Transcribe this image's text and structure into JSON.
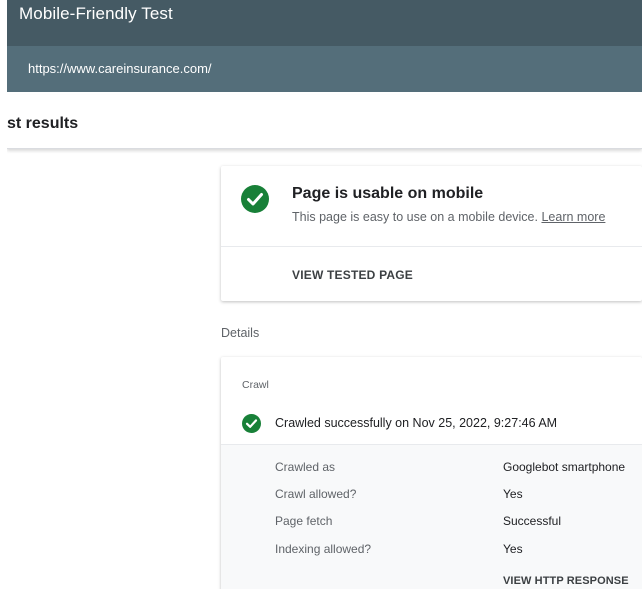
{
  "header": {
    "title": "Mobile-Friendly Test",
    "url": "https://www.careinsurance.com/"
  },
  "results": {
    "title": "st results"
  },
  "usable_card": {
    "title": "Page is usable on mobile",
    "subtitle": "This page is easy to use on a mobile device.",
    "learn_more": "Learn more",
    "view_tested_page": "VIEW TESTED PAGE"
  },
  "details": {
    "label": "Details",
    "crawl_label": "Crawl",
    "crawl_status": "Crawled successfully on Nov 25, 2022, 9:27:46 AM",
    "rows": [
      {
        "key": "Crawled as",
        "value": "Googlebot smartphone"
      },
      {
        "key": "Crawl allowed?",
        "value": "Yes"
      },
      {
        "key": "Page fetch",
        "value": "Successful"
      },
      {
        "key": "Indexing allowed?",
        "value": "Yes"
      }
    ],
    "view_http_response": "VIEW HTTP RESPONSE"
  },
  "colors": {
    "app_bar": "#455a64",
    "url_bar": "#546e7a",
    "success_green": "#188038"
  },
  "icons": {
    "usable": "check-circle-icon",
    "crawl": "check-circle-icon"
  }
}
